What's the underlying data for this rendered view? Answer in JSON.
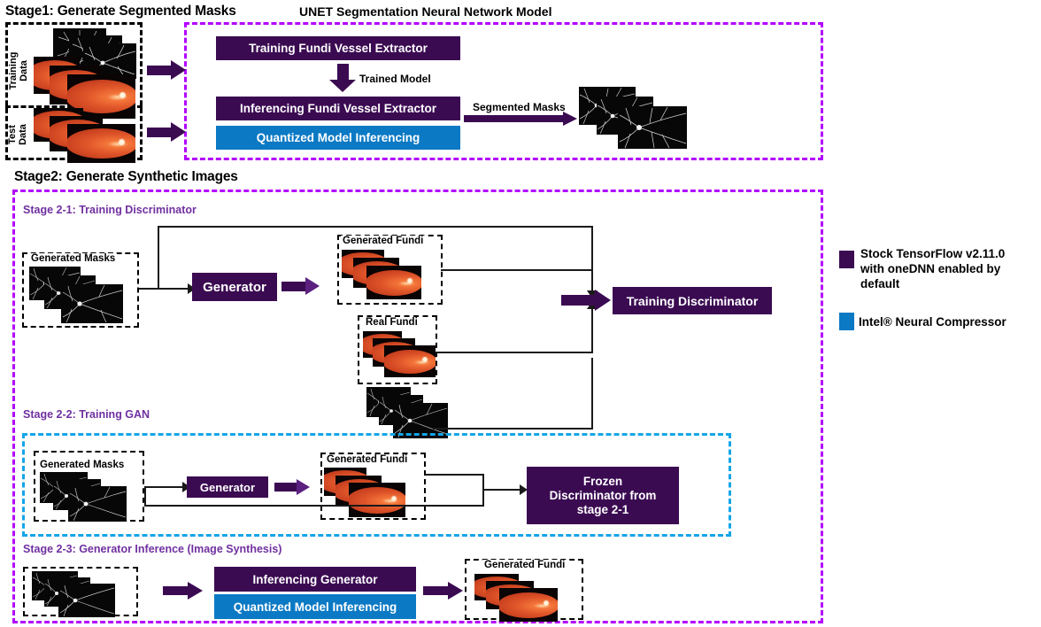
{
  "stage1": {
    "title": "Stage1: Generate Segmented Masks",
    "unet_title": "UNET Segmentation Neural Network Model",
    "training_data_label": "Training\nData",
    "training_data_label_l1": "Training",
    "training_data_label_l2": "Data",
    "test_data_label_l1": "Test",
    "test_data_label_l2": "Data",
    "box_training_extractor": "Training Fundi Vessel  Extractor",
    "trained_model_label": "Trained Model",
    "box_inferencing_extractor": "Inferencing Fundi Vessel  Extractor",
    "box_quantized": "Quantized Model Inferencing",
    "segmented_masks_label": "Segmented  Masks"
  },
  "stage2": {
    "title": "Stage2: Generate Synthetic Images",
    "s21": {
      "title": "Stage 2-1: Training Discriminator",
      "generated_masks_caption": "Generated Masks",
      "generator_box": "Generator",
      "generated_fundi_caption": "Generated Fundi",
      "real_fundi_caption": "Real Fundi",
      "discriminator_box": "Training Discriminator"
    },
    "s22": {
      "title": "Stage 2-2: Training GAN",
      "generated_masks_caption": "Generated Masks",
      "generator_box": "Generator",
      "generated_fundi_caption": "Generated Fundi",
      "frozen_box_l1": "Frozen",
      "frozen_box_l2": "Discriminator from",
      "frozen_box_l3": "stage 2-1"
    },
    "s23": {
      "title": "Stage 2-3: Generator Inference (Image Synthesis)",
      "inferencing_generator_box": "Inferencing Generator",
      "quantized_box": "Quantized Model Inferencing",
      "generated_fundi_caption": "Generated Fundi"
    }
  },
  "legend": {
    "items": [
      {
        "color": "#3b0b52",
        "label": "Stock TensorFlow v2.11.0 with oneDNN enabled by default"
      },
      {
        "color": "#0b79c4",
        "label": "Intel® Neural Compressor"
      }
    ],
    "item0_l1": "Stock TensorFlow v2.11.0",
    "item0_l2": "with oneDNN enabled by",
    "item0_l3": "default",
    "item1_l1": "Intel® Neural Compressor"
  },
  "colors": {
    "purple": "#3b0b52",
    "blue": "#0b79c4",
    "magenta_dash": "#b300ff",
    "cyan_dash": "#12a5e8",
    "substage_label": "#7030A0"
  }
}
